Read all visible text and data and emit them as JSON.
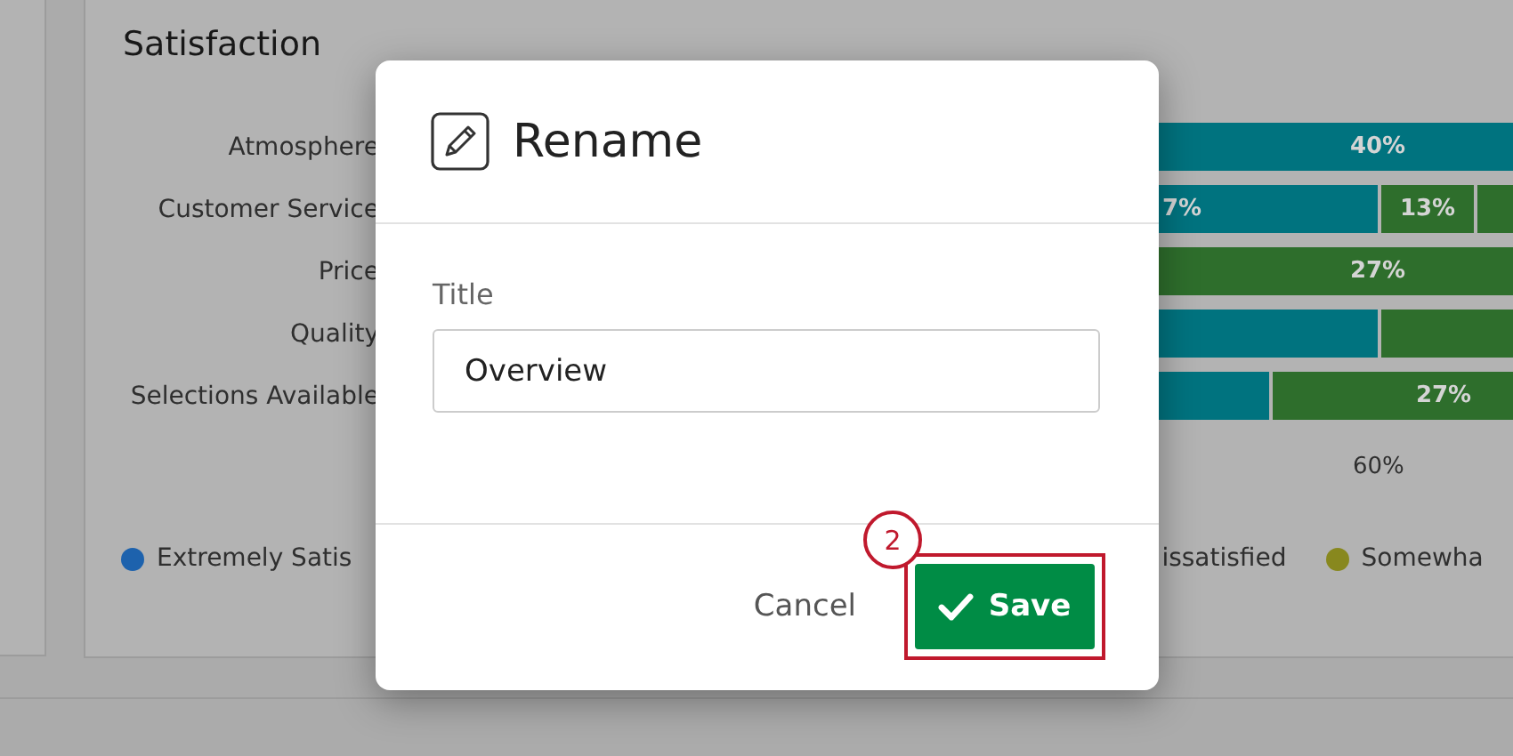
{
  "background": {
    "chart_title": "Satisfaction",
    "rows": [
      {
        "label": "Atmosphere",
        "segments": [
          {
            "color": "#00737f",
            "label": "40%"
          }
        ]
      },
      {
        "label": "Customer Service",
        "segments": [
          {
            "color": "#00737f",
            "label": "7%"
          },
          {
            "color": "#2e6e2c",
            "label": "13%"
          },
          {
            "color": "#2e6e2c"
          }
        ]
      },
      {
        "label": "Price",
        "segments": [
          {
            "color": "#2e6e2c",
            "label": "27%"
          }
        ]
      },
      {
        "label": "Quality",
        "segments": [
          {
            "color": "#00737f"
          },
          {
            "color": "#2e6e2c"
          }
        ]
      },
      {
        "label": "Selections Available",
        "segments": [
          {
            "color": "#00737f"
          },
          {
            "color": "#2e6e2c",
            "label": "27%"
          }
        ]
      }
    ],
    "axis_ticks": [
      "60%"
    ],
    "legend": [
      {
        "label": "Extremely Satis",
        "color": "#1d62ad"
      },
      {
        "label": "issatisfied"
      },
      {
        "label": "Somewha",
        "color": "#88881e"
      }
    ]
  },
  "dialog": {
    "title": "Rename",
    "field_label": "Title",
    "field_value": "Overview",
    "buttons": [
      {
        "label": "Cancel",
        "kind": "secondary"
      },
      {
        "label": "Save",
        "kind": "primary"
      }
    ]
  },
  "annotation": {
    "number": "2"
  }
}
